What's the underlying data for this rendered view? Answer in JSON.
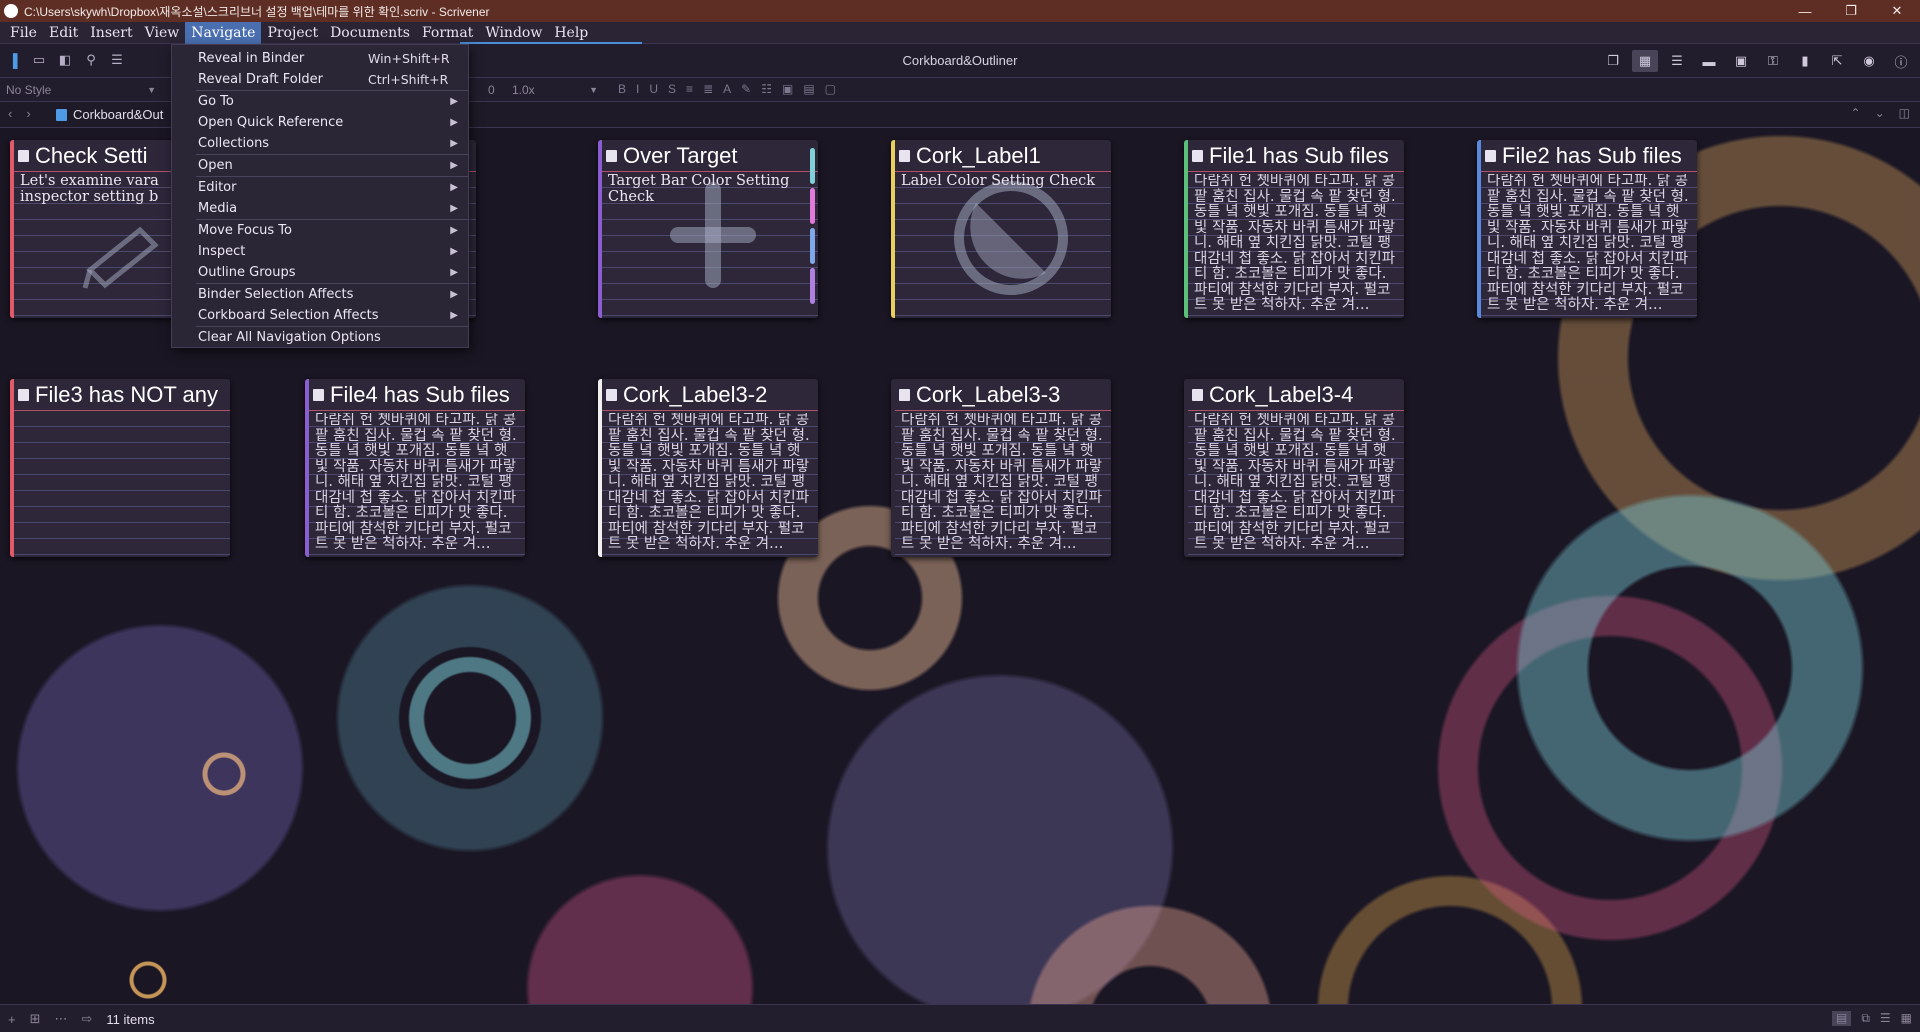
{
  "window": {
    "title": "C:\\Users\\skywh\\Dropbox\\재옥소설\\스크리브너 설정 백업\\테마를 위한 확인.scriv - Scrivener",
    "controls": [
      "—",
      "❐",
      "✕"
    ]
  },
  "menubar": [
    "File",
    "Edit",
    "Insert",
    "View",
    "Navigate",
    "Project",
    "Documents",
    "Format",
    "Window",
    "Help"
  ],
  "toolbar": {
    "center_title": "Corkboard&Outliner"
  },
  "formatbar": {
    "style": "No Style",
    "size": "0",
    "zoom": "1.0x"
  },
  "navbar": {
    "doc_title": "Corkboard&Out"
  },
  "navigate_menu": [
    {
      "label": "Reveal in Binder",
      "shortcut": "Win+Shift+R",
      "submenu": false
    },
    {
      "label": "Reveal Draft Folder",
      "shortcut": "Ctrl+Shift+R",
      "submenu": false
    },
    {
      "sep": true
    },
    {
      "label": "Go To",
      "shortcut": "",
      "submenu": true
    },
    {
      "label": "Open Quick Reference",
      "shortcut": "",
      "submenu": true
    },
    {
      "label": "Collections",
      "shortcut": "",
      "submenu": true
    },
    {
      "sep": true
    },
    {
      "label": "Open",
      "shortcut": "",
      "submenu": true
    },
    {
      "sep": true
    },
    {
      "label": "Editor",
      "shortcut": "",
      "submenu": true
    },
    {
      "label": "Media",
      "shortcut": "",
      "submenu": true
    },
    {
      "sep": true
    },
    {
      "label": "Move Focus To",
      "shortcut": "",
      "submenu": true
    },
    {
      "label": "Inspect",
      "shortcut": "",
      "submenu": true
    },
    {
      "label": "Outline Groups",
      "shortcut": "",
      "submenu": true
    },
    {
      "sep": true
    },
    {
      "label": "Binder Selection Affects",
      "shortcut": "",
      "submenu": true
    },
    {
      "label": "Corkboard Selection Affects",
      "shortcut": "",
      "submenu": true
    },
    {
      "sep": true
    },
    {
      "label": "Clear All Navigation Options",
      "shortcut": "",
      "submenu": false
    }
  ],
  "korean_text": "다람쥐 헌 쳇바퀴에 타고파. 닭 콩팥 훔친 집사. 물컵 속 팥 찾던 형. 동틀 녘 햇빛 포개짐. 동틀 녘 햇빛 작품. 자동차 바퀴 틈새가 파랗니. 해태 옆 치킨집 닭맛. 코털 팽 대감네 첩 좋소. 닭 잡아서 치킨파티 함. 초코볼은 티피가 맛 좋다. 파티에 참석한 키다리 부자. 펄코트 못 받은 척하자. 추운 겨…",
  "cards": [
    {
      "title": "Check Setti",
      "synopsis": "Let's examine vara inspector setting b",
      "label_color": "#e05a6a",
      "watermark": "pencil-icon"
    },
    {
      "title": "",
      "synopsis": "",
      "label_color": "#e0a04a",
      "watermark": ""
    },
    {
      "title": "Over Target",
      "synopsis": "Target Bar Color Setting Check",
      "label_color": "#8a5ed0",
      "watermark": "cross-icon",
      "flags": [
        "#7fd0d8",
        "#e07ad8",
        "#80a8e8",
        "#b080e0"
      ]
    },
    {
      "title": "Cork_Label1",
      "synopsis": "Label Color Setting Check",
      "label_color": "#e8d05a",
      "watermark": "no-entry-icon"
    },
    {
      "title": "File1 has Sub files",
      "synopsis": "",
      "label_color": "#5ac07a",
      "watermark": ""
    },
    {
      "title": "File2 has Sub files",
      "synopsis": "",
      "label_color": "#5a8ae0",
      "watermark": ""
    },
    {
      "title": "File3 has NOT any …",
      "synopsis": "",
      "label_color": "#e05a6a",
      "watermark": ""
    },
    {
      "title": "File4 has Sub files",
      "synopsis": "",
      "label_color": "#8a5ed0",
      "watermark": ""
    },
    {
      "title": "Cork_Label3-2",
      "synopsis": "",
      "label_color": "#f0f0f0",
      "watermark": ""
    },
    {
      "title": "Cork_Label3-3",
      "synopsis": "",
      "label_color": "#2d2739",
      "watermark": ""
    },
    {
      "title": "Cork_Label3-4",
      "synopsis": "",
      "label_color": "#2d2739",
      "watermark": ""
    }
  ],
  "statusbar": {
    "count": "11 items"
  },
  "colors": {
    "titlebar": "#5e2e25",
    "menu_highlight": "#4a6fb0",
    "card_bg": "#2d2739"
  }
}
